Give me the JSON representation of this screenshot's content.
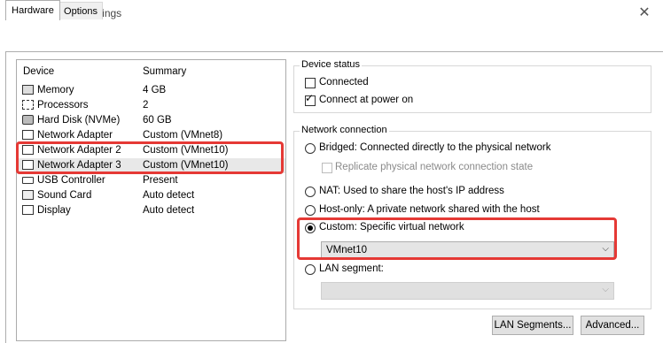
{
  "window": {
    "title": "Virtual Machine Settings",
    "close_glyph": "✕"
  },
  "tabs": [
    {
      "label": "Hardware",
      "active": true
    },
    {
      "label": "Options",
      "active": false
    }
  ],
  "device_list": {
    "col_device": "Device",
    "col_summary": "Summary",
    "rows": [
      {
        "icon": "memory-icon",
        "name": "Memory",
        "summary": "4 GB"
      },
      {
        "icon": "processor-icon",
        "name": "Processors",
        "summary": "2"
      },
      {
        "icon": "hard-disk-icon",
        "name": "Hard Disk (NVMe)",
        "summary": "60 GB"
      },
      {
        "icon": "network-adapter-icon",
        "name": "Network Adapter",
        "summary": "Custom (VMnet8)"
      },
      {
        "icon": "network-adapter-icon",
        "name": "Network Adapter 2",
        "summary": "Custom (VMnet10)"
      },
      {
        "icon": "network-adapter-icon",
        "name": "Network Adapter 3",
        "summary": "Custom (VMnet10)",
        "selected": true
      },
      {
        "icon": "usb-controller-icon",
        "name": "USB Controller",
        "summary": "Present"
      },
      {
        "icon": "sound-card-icon",
        "name": "Sound Card",
        "summary": "Auto detect"
      },
      {
        "icon": "display-icon",
        "name": "Display",
        "summary": "Auto detect"
      }
    ]
  },
  "device_status": {
    "label": "Device status",
    "connected": {
      "label": "Connected",
      "checked": false
    },
    "connect_at_power_on": {
      "label": "Connect at power on",
      "checked": true
    }
  },
  "network_connection": {
    "label": "Network connection",
    "bridged": {
      "label": "Bridged: Connected directly to the physical network",
      "selected": false
    },
    "replicate": {
      "label": "Replicate physical network connection state",
      "checked": false,
      "enabled": false
    },
    "nat": {
      "label": "NAT: Used to share the host's IP address",
      "selected": false
    },
    "host_only": {
      "label": "Host-only: A private network shared with the host",
      "selected": false
    },
    "custom": {
      "label": "Custom: Specific virtual network",
      "selected": true
    },
    "custom_network": {
      "value": "VMnet10"
    },
    "lan_segment": {
      "label": "LAN segment:",
      "selected": false,
      "value": ""
    }
  },
  "buttons": {
    "lan_segments": "LAN Segments...",
    "advanced": "Advanced..."
  },
  "glyphs": {
    "check": "✓",
    "chevron": "⌵"
  },
  "colors": {
    "highlight_red": "#e53935",
    "selected_row": "#e8e8e8"
  }
}
